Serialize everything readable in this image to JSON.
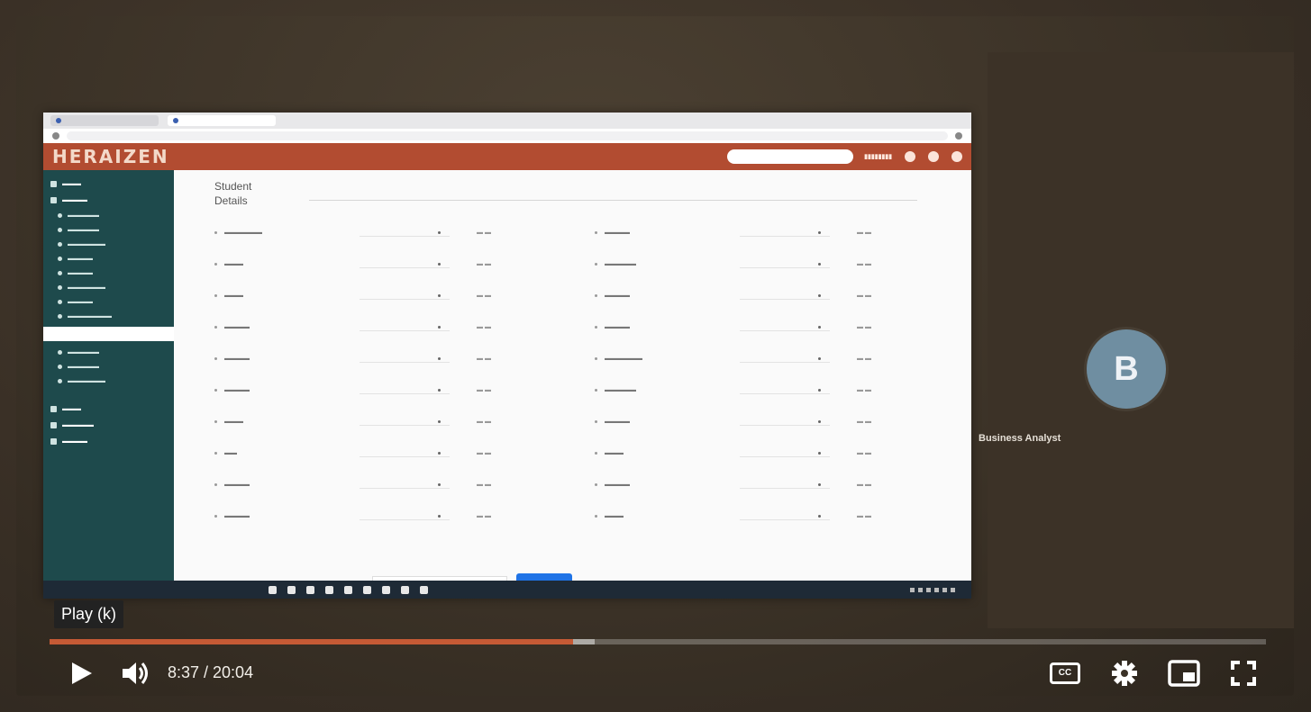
{
  "player": {
    "tooltip": "Play (k)",
    "time": "8:37 / 20:04",
    "progress_fraction": 0.43,
    "buffered_fraction": 0.448,
    "accent": "#c55a35"
  },
  "participant": {
    "initial": "B",
    "name": "Business Analyst",
    "avatar_color": "#6f8ea1"
  },
  "app": {
    "logo": "HERAIZEN",
    "brand_color": "#b24c31",
    "sidebar_color": "#1e4a4c",
    "section_title_line1": "Student",
    "section_title_line2": "Details"
  },
  "icons": {
    "play": "play-icon",
    "volume": "volume-icon",
    "captions": "captions-icon",
    "settings": "gear-icon",
    "miniplayer": "miniplayer-icon",
    "fullscreen": "fullscreen-icon"
  }
}
